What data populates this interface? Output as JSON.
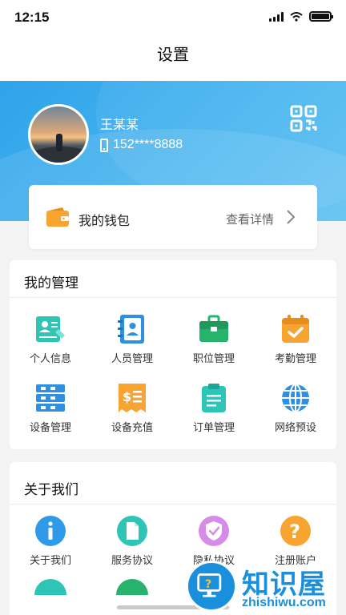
{
  "status_bar": {
    "time": "12:15"
  },
  "nav": {
    "title": "设置"
  },
  "profile": {
    "name": "王某某",
    "phone": "152****8888"
  },
  "wallet": {
    "label": "我的钱包",
    "detail": "查看详情"
  },
  "management": {
    "title": "我的管理",
    "items": [
      {
        "label": "个人信息",
        "icon": "id-card-icon"
      },
      {
        "label": "人员管理",
        "icon": "contact-book-icon"
      },
      {
        "label": "职位管理",
        "icon": "briefcase-icon"
      },
      {
        "label": "考勤管理",
        "icon": "calendar-check-icon"
      },
      {
        "label": "设备管理",
        "icon": "device-rack-icon"
      },
      {
        "label": "设备充值",
        "icon": "recharge-receipt-icon"
      },
      {
        "label": "订单管理",
        "icon": "clipboard-icon"
      },
      {
        "label": "网络预设",
        "icon": "globe-icon"
      }
    ]
  },
  "about": {
    "title": "关于我们",
    "items": [
      {
        "label": "关于我们",
        "icon": "info-icon"
      },
      {
        "label": "服务协议",
        "icon": "document-icon"
      },
      {
        "label": "隐私协议",
        "icon": "shield-check-icon"
      },
      {
        "label": "注册账户",
        "icon": "question-icon"
      }
    ]
  },
  "watermark": {
    "name": "知识屋",
    "url": "zhishiwu.com"
  },
  "colors": {
    "primary": "#3aa8ec",
    "teal": "#2ec4b6",
    "orange": "#f7a530",
    "green": "#27b36b",
    "purple": "#d68be8"
  }
}
